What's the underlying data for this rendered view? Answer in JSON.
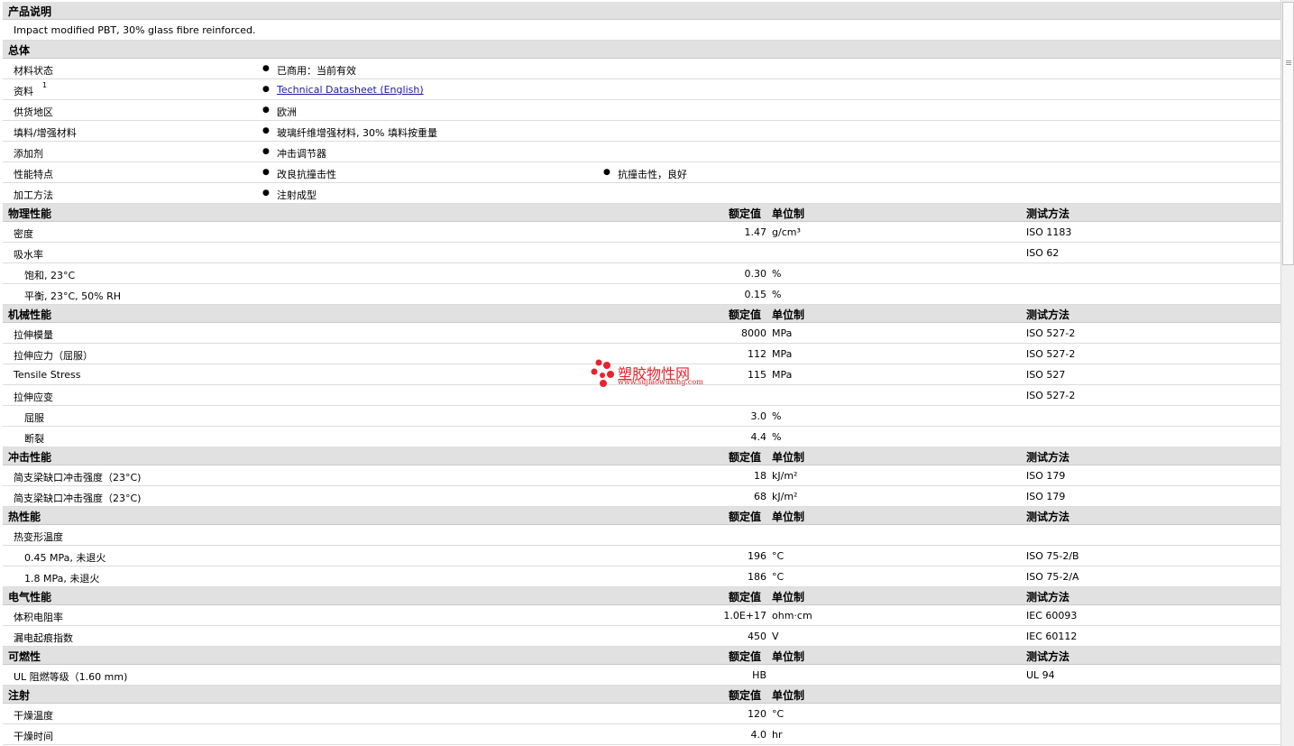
{
  "labels": {
    "value": "额定值",
    "unit": "单位制",
    "test": "测试方法"
  },
  "description": {
    "title": "产品说明",
    "text": "Impact modified PBT, 30% glass fibre reinforced."
  },
  "general": {
    "title": "总体",
    "rows": [
      {
        "name": "材料状态",
        "items": [
          "已商用：当前有效"
        ]
      },
      {
        "name": "资料",
        "sup": "1",
        "items": [
          "Technical Datasheet (English)"
        ],
        "link": true
      },
      {
        "name": "供货地区",
        "items": [
          "欧洲"
        ]
      },
      {
        "name": "填料/增强材料",
        "items": [
          "玻璃纤维增强材料, 30% 填料按重量"
        ]
      },
      {
        "name": "添加剂",
        "items": [
          "冲击调节器"
        ]
      },
      {
        "name": "性能特点",
        "items": [
          "改良抗撞击性",
          "抗撞击性，良好"
        ]
      },
      {
        "name": "加工方法",
        "items": [
          "注射成型"
        ]
      }
    ]
  },
  "sections": [
    {
      "title": "物理性能",
      "show_test": true,
      "rows": [
        {
          "name": "密度",
          "value": "1.47",
          "unit": "g/cm³",
          "test": "ISO 1183"
        },
        {
          "name": "吸水率",
          "value": "",
          "unit": "",
          "test": "ISO 62"
        },
        {
          "name": "饱和, 23°C",
          "sub": true,
          "value": "0.30",
          "unit": "%",
          "test": ""
        },
        {
          "name": "平衡, 23°C, 50% RH",
          "sub": true,
          "value": "0.15",
          "unit": "%",
          "test": ""
        }
      ]
    },
    {
      "title": "机械性能",
      "show_test": true,
      "rows": [
        {
          "name": "拉伸模量",
          "value": "8000",
          "unit": "MPa",
          "test": "ISO 527-2"
        },
        {
          "name": "拉伸应力（屈服）",
          "value": "112",
          "unit": "MPa",
          "test": "ISO 527-2"
        },
        {
          "name": "Tensile Stress",
          "value": "115",
          "unit": "MPa",
          "test": "ISO 527"
        },
        {
          "name": "拉伸应变",
          "value": "",
          "unit": "",
          "test": "ISO 527-2"
        },
        {
          "name": "屈服",
          "sub": true,
          "value": "3.0",
          "unit": "%",
          "test": ""
        },
        {
          "name": "断裂",
          "sub": true,
          "value": "4.4",
          "unit": "%",
          "test": ""
        }
      ]
    },
    {
      "title": "冲击性能",
      "show_test": true,
      "rows": [
        {
          "name": "简支梁缺口冲击强度（23°C)",
          "value": "18",
          "unit": "kJ/m²",
          "test": "ISO 179"
        },
        {
          "name": "简支梁缺口冲击强度（23°C)",
          "value": "68",
          "unit": "kJ/m²",
          "test": "ISO 179"
        }
      ]
    },
    {
      "title": "热性能",
      "show_test": true,
      "rows": [
        {
          "name": "热变形温度",
          "value": "",
          "unit": "",
          "test": ""
        },
        {
          "name": "0.45 MPa, 未退火",
          "sub": true,
          "value": "196",
          "unit": "°C",
          "test": "ISO 75-2/B"
        },
        {
          "name": "1.8 MPa, 未退火",
          "sub": true,
          "value": "186",
          "unit": "°C",
          "test": "ISO 75-2/A"
        }
      ]
    },
    {
      "title": "电气性能",
      "show_test": true,
      "rows": [
        {
          "name": "体积电阻率",
          "value": "1.0E+17",
          "unit": "ohm·cm",
          "test": "IEC 60093"
        },
        {
          "name": "漏电起痕指数",
          "value": "450",
          "unit": "V",
          "test": "IEC 60112"
        }
      ]
    },
    {
      "title": "可燃性",
      "show_test": true,
      "rows": [
        {
          "name": "UL 阻燃等级（1.60 mm)",
          "value": "HB",
          "unit": "",
          "test": "UL 94"
        }
      ]
    },
    {
      "title": "注射",
      "show_test": false,
      "rows": [
        {
          "name": "干燥温度",
          "value": "120",
          "unit": "°C",
          "test": ""
        },
        {
          "name": "干燥时间",
          "value": "4.0",
          "unit": "hr",
          "test": ""
        }
      ]
    }
  ],
  "watermark": {
    "text": "塑胶物性网",
    "url": "www.sujiaowuxing.com",
    "color": "#e8232b"
  }
}
